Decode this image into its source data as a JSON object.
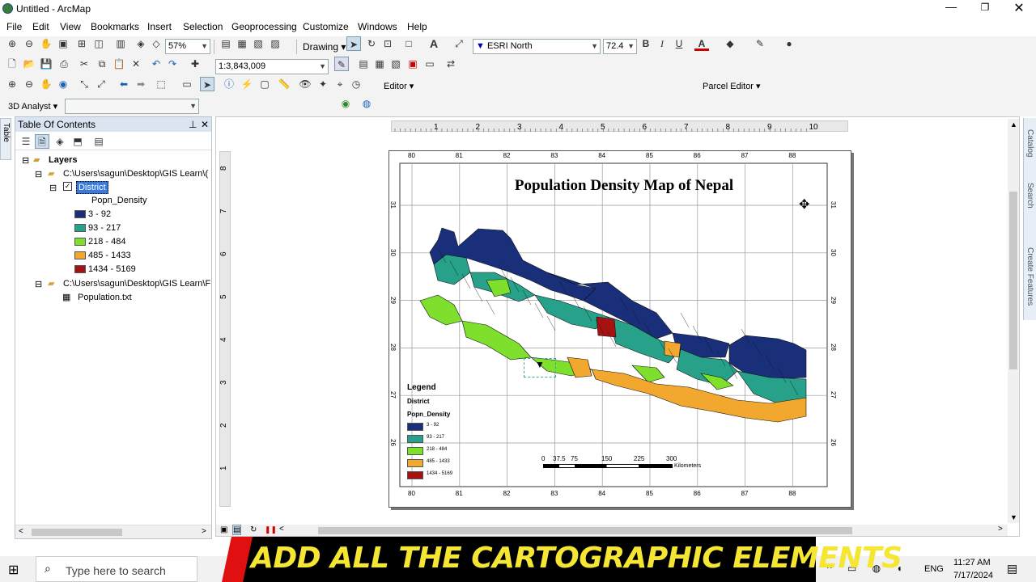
{
  "window": {
    "title": "Untitled - ArcMap"
  },
  "menu": [
    "File",
    "Edit",
    "View",
    "Bookmarks",
    "Insert",
    "Selection",
    "Geoprocessing",
    "Customize",
    "Windows",
    "Help"
  ],
  "toolbar": {
    "zoom": "57%",
    "scale": "1:3,843,009",
    "drawing_label": "Drawing",
    "font_name": "ESRI North",
    "font_size": "72.4",
    "editor_label": "Editor",
    "parcel_editor_label": "Parcel Editor",
    "analyst_label": "3D Analyst"
  },
  "toc": {
    "title": "Table Of Contents",
    "layers_label": "Layers",
    "path1": "C:\\Users\\sagun\\Desktop\\GIS Learn\\(",
    "layer_name": "District",
    "field": "Popn_Density",
    "classes": [
      {
        "label": "3 - 92",
        "color": "#1a2f7a"
      },
      {
        "label": "93 - 217",
        "color": "#27a189"
      },
      {
        "label": "218 - 484",
        "color": "#7ee02d"
      },
      {
        "label": "485 - 1433",
        "color": "#f2a72e"
      },
      {
        "label": "1434 - 5169",
        "color": "#a51212"
      }
    ],
    "path2": "C:\\Users\\sagun\\Desktop\\GIS Learn\\F",
    "table_name": "Population.txt"
  },
  "side_tabs": {
    "left": "Table",
    "right": [
      "Catalog",
      "Search",
      "Create Features"
    ]
  },
  "ruler": {
    "h": [
      "1",
      "2",
      "3",
      "4",
      "5",
      "6",
      "7",
      "8",
      "9",
      "10"
    ],
    "v": [
      "8",
      "7",
      "6",
      "5",
      "4",
      "3",
      "2",
      "1"
    ]
  },
  "map": {
    "title": "Population Density Map of Nepal",
    "lon_ticks": [
      "80",
      "81",
      "82",
      "83",
      "84",
      "85",
      "86",
      "87",
      "88"
    ],
    "lat_ticks": [
      "31",
      "30",
      "29",
      "28",
      "27",
      "26"
    ],
    "legend": {
      "title": "Legend",
      "layer": "District",
      "field": "Popn_Density"
    },
    "scalebar": {
      "labels": [
        "0",
        "37.5",
        "75",
        "150",
        "225",
        "300"
      ],
      "unit": "Kilometers"
    }
  },
  "caption": "ADD ALL THE CARTOGRAPHIC ELEMENTS",
  "taskbar": {
    "search_placeholder": "Type here to search",
    "lang": "ENG",
    "time": "11:27 AM",
    "date": "7/17/2024"
  }
}
